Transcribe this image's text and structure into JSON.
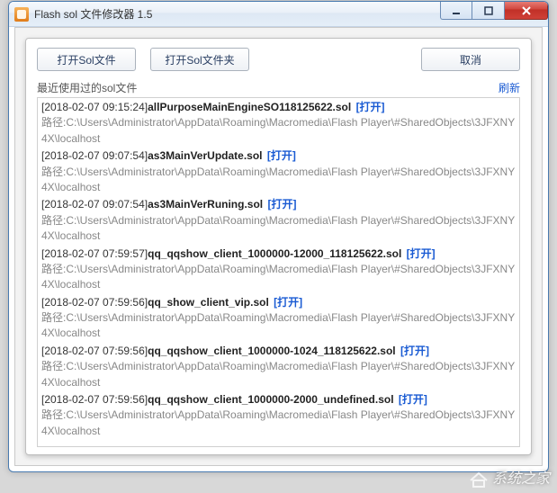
{
  "window": {
    "title": "Flash sol 文件修改器 1.5"
  },
  "buttons": {
    "open_file": "打开Sol文件",
    "open_folder": "打开Sol文件夹",
    "cancel": "取消"
  },
  "section": {
    "recent_label": "最近使用过的sol文件",
    "refresh": "刷新",
    "open_link": "[打开]"
  },
  "recent_files": [
    {
      "timestamp": "2018-02-07 09:15:24",
      "filename": "allPurposeMainEngineSO118125622.sol",
      "path": "路径:C:\\Users\\Administrator\\AppData\\Roaming\\Macromedia\\Flash Player\\#SharedObjects\\3JFXNY4X\\localhost"
    },
    {
      "timestamp": "2018-02-07 09:07:54",
      "filename": "as3MainVerUpdate.sol",
      "path": "路径:C:\\Users\\Administrator\\AppData\\Roaming\\Macromedia\\Flash Player\\#SharedObjects\\3JFXNY4X\\localhost"
    },
    {
      "timestamp": "2018-02-07 09:07:54",
      "filename": "as3MainVerRuning.sol",
      "path": "路径:C:\\Users\\Administrator\\AppData\\Roaming\\Macromedia\\Flash Player\\#SharedObjects\\3JFXNY4X\\localhost"
    },
    {
      "timestamp": "2018-02-07 07:59:57",
      "filename": "qq_qqshow_client_1000000-12000_118125622.sol",
      "path": "路径:C:\\Users\\Administrator\\AppData\\Roaming\\Macromedia\\Flash Player\\#SharedObjects\\3JFXNY4X\\localhost"
    },
    {
      "timestamp": "2018-02-07 07:59:56",
      "filename": "qq_show_client_vip.sol",
      "path": "路径:C:\\Users\\Administrator\\AppData\\Roaming\\Macromedia\\Flash Player\\#SharedObjects\\3JFXNY4X\\localhost"
    },
    {
      "timestamp": "2018-02-07 07:59:56",
      "filename": "qq_qqshow_client_1000000-1024_118125622.sol",
      "path": "路径:C:\\Users\\Administrator\\AppData\\Roaming\\Macromedia\\Flash Player\\#SharedObjects\\3JFXNY4X\\localhost"
    },
    {
      "timestamp": "2018-02-07 07:59:56",
      "filename": "qq_qqshow_client_1000000-2000_undefined.sol",
      "path": "路径:C:\\Users\\Administrator\\AppData\\Roaming\\Macromedia\\Flash Player\\#SharedObjects\\3JFXNY4X\\localhost"
    }
  ],
  "watermark": "系统之家"
}
